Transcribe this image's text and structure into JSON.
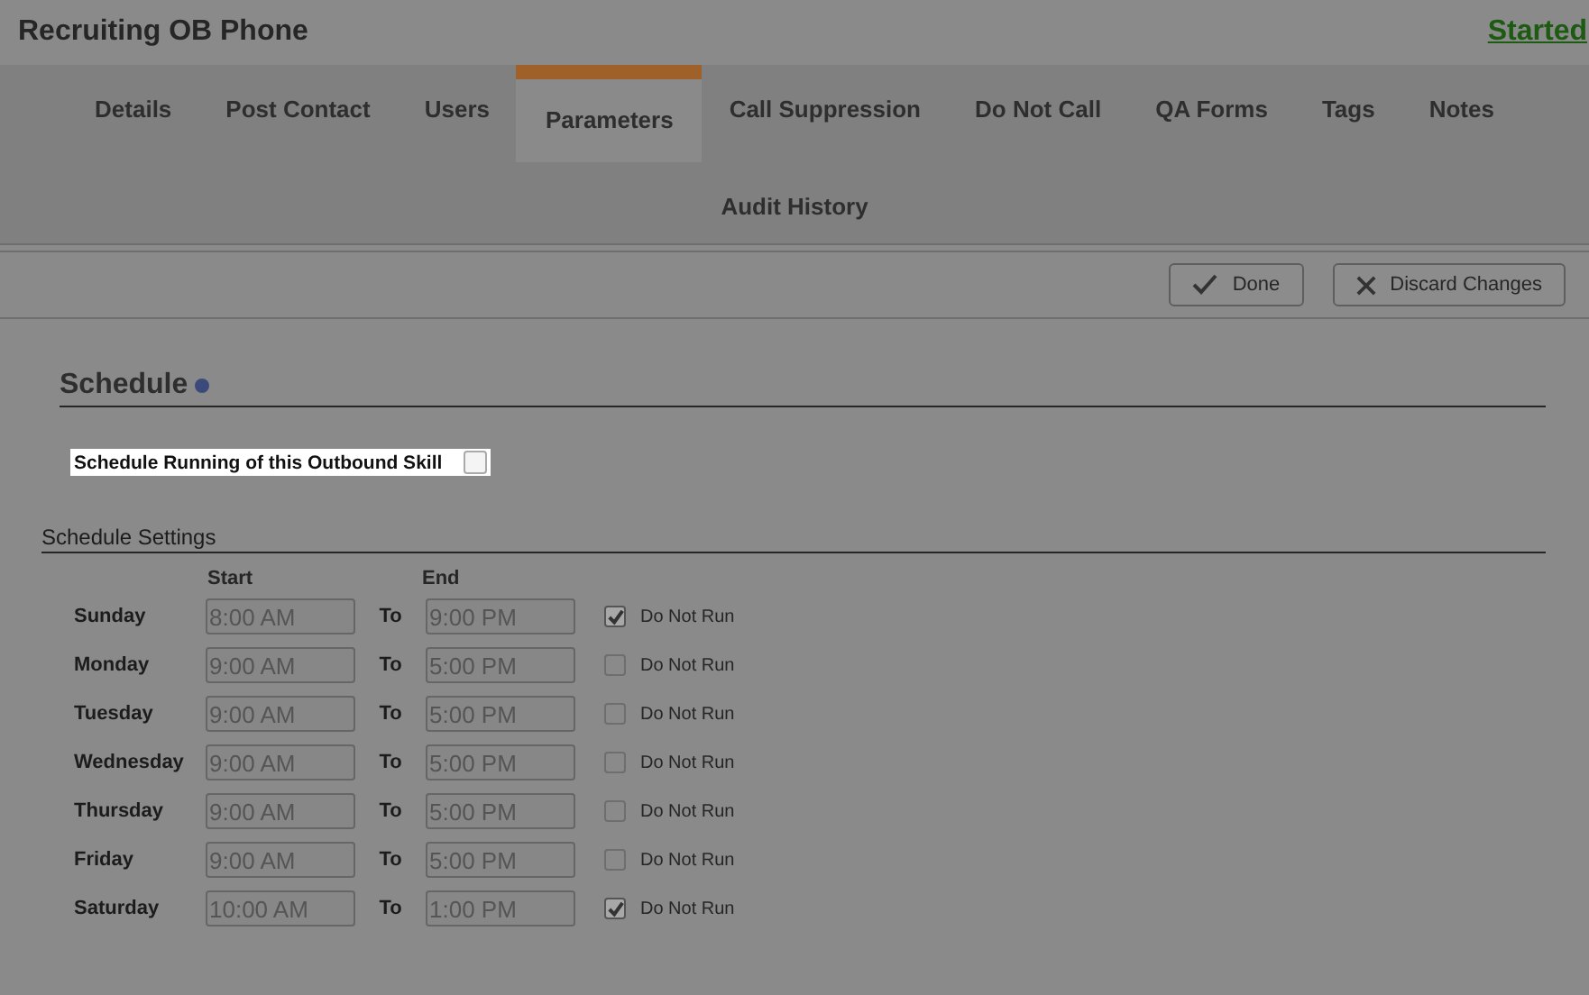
{
  "header": {
    "title": "Recruiting OB Phone",
    "status": "Started"
  },
  "tabs": [
    {
      "label": "Details",
      "selected": false
    },
    {
      "label": "Post Contact",
      "selected": false
    },
    {
      "label": "Users",
      "selected": false
    },
    {
      "label": "Parameters",
      "selected": true
    },
    {
      "label": "Call Suppression",
      "selected": false
    },
    {
      "label": "Do Not Call",
      "selected": false
    },
    {
      "label": "QA Forms",
      "selected": false
    },
    {
      "label": "Tags",
      "selected": false
    },
    {
      "label": "Notes",
      "selected": false
    },
    {
      "label": "Audit History",
      "selected": false
    }
  ],
  "toolbar": {
    "done": "Done",
    "discard": "Discard Changes"
  },
  "schedule": {
    "title": "Schedule",
    "enable_label": "Schedule Running of this Outbound Skill",
    "enabled": false
  },
  "settings": {
    "title": "Schedule Settings",
    "start_header": "Start",
    "end_header": "End",
    "days": [
      {
        "day": "Sunday",
        "start": "8:00 AM",
        "to": "To",
        "end": "9:00 PM",
        "do_not_run": true,
        "do_not_run_label": "Do Not Run"
      },
      {
        "day": "Monday",
        "start": "9:00 AM",
        "to": "To",
        "end": "5:00 PM",
        "do_not_run": false,
        "do_not_run_label": "Do Not Run"
      },
      {
        "day": "Tuesday",
        "start": "9:00 AM",
        "to": "To",
        "end": "5:00 PM",
        "do_not_run": false,
        "do_not_run_label": "Do Not Run"
      },
      {
        "day": "Wednesday",
        "start": "9:00 AM",
        "to": "To",
        "end": "5:00 PM",
        "do_not_run": false,
        "do_not_run_label": "Do Not Run"
      },
      {
        "day": "Thursday",
        "start": "9:00 AM",
        "to": "To",
        "end": "5:00 PM",
        "do_not_run": false,
        "do_not_run_label": "Do Not Run"
      },
      {
        "day": "Friday",
        "start": "9:00 AM",
        "to": "To",
        "end": "5:00 PM",
        "do_not_run": false,
        "do_not_run_label": "Do Not Run"
      },
      {
        "day": "Saturday",
        "start": "10:00 AM",
        "to": "To",
        "end": "1:00 PM",
        "do_not_run": true,
        "do_not_run_label": "Do Not Run"
      }
    ]
  }
}
